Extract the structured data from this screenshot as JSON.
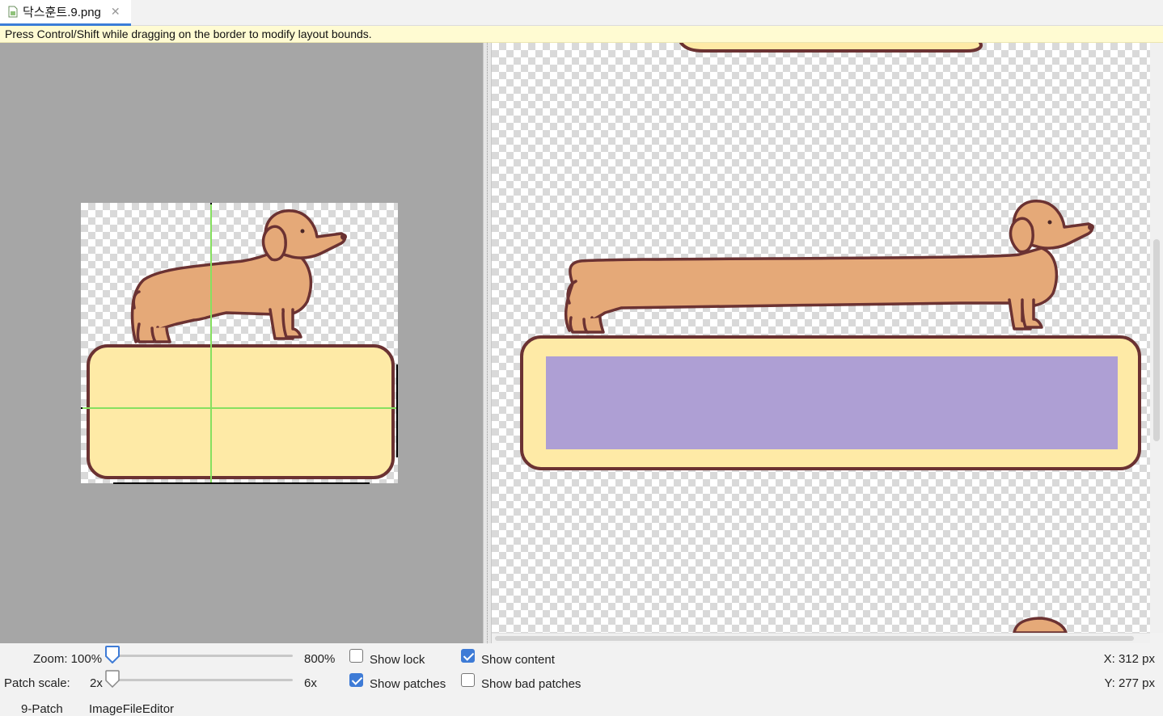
{
  "tab": {
    "title": "닥스훈트.9.png",
    "close": "✕"
  },
  "infobar": {
    "text": "Press Control/Shift while dragging on the border to modify layout bounds."
  },
  "controls": {
    "zoom_label": "Zoom: 100%",
    "zoom_max": "800%",
    "zoom_level": 0.0,
    "patch_scale_label": "Patch scale:",
    "patch_scale_min": "2x",
    "patch_scale_max": "6x",
    "patch_scale_level": 0.0,
    "show_lock": {
      "label": "Show lock",
      "checked": false
    },
    "show_content": {
      "label": "Show content",
      "checked": true
    },
    "show_patches": {
      "label": "Show patches",
      "checked": true
    },
    "show_bad_patches": {
      "label": "Show bad patches",
      "checked": false
    },
    "x_readout": "X: 312 px",
    "y_readout": "Y: 277 px"
  },
  "bottom_tabs": [
    "9-Patch",
    "ImageFileEditor"
  ],
  "colors": {
    "dog_fill": "#e5a978",
    "outline": "#6b3232",
    "box_fill": "#feeaa6",
    "content_area": "#ae9fd4",
    "patch_guide": "#86e060",
    "accent": "#3e7bd6"
  }
}
